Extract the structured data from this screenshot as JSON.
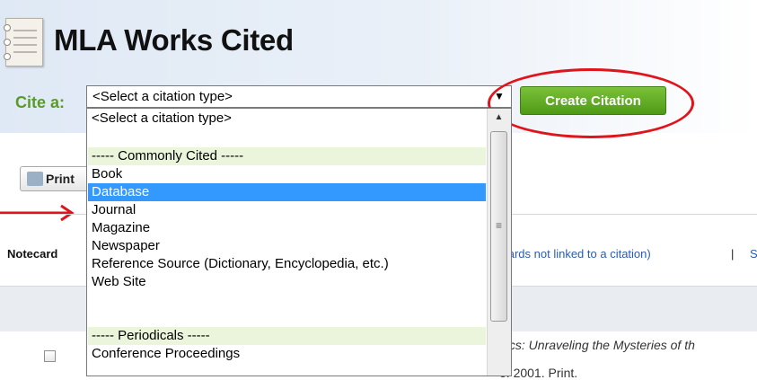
{
  "header": {
    "title": "MLA Works Cited",
    "cite_label": "Cite a:",
    "select_value": "<Select a citation type>",
    "create_button": "Create Citation"
  },
  "toolbar": {
    "print_label": "Print"
  },
  "notecards": {
    "label": "Notecard",
    "link_text": "ecards not linked to a citation)",
    "separator": "|",
    "cut_text": "S"
  },
  "entry": {
    "title_fragment": "nics: Unraveling the Mysteries of th",
    "tail_fragment": "e. 2001. Print."
  },
  "dropdown": {
    "items": [
      "<Select a citation type>",
      "",
      "----- Commonly Cited -----",
      "Book",
      "Database",
      "Journal",
      "Magazine",
      "Newspaper",
      "Reference Source (Dictionary, Encyclopedia, etc.)",
      "Web Site",
      "",
      "----- Periodicals -----",
      "Conference Proceedings"
    ],
    "selected": "Database"
  },
  "colors": {
    "accent_green": "#5a9a2a",
    "button_green": "#4e9a16",
    "highlight_blue": "#3399ff",
    "annotation_red": "#e0151b"
  }
}
